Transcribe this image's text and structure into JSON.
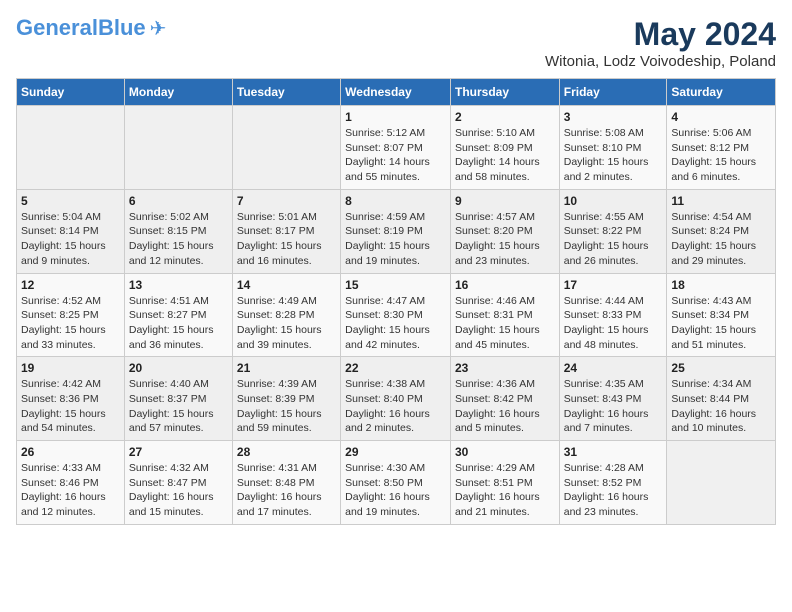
{
  "header": {
    "logo_general": "General",
    "logo_blue": "Blue",
    "main_title": "May 2024",
    "subtitle": "Witonia, Lodz Voivodeship, Poland"
  },
  "days_of_week": [
    "Sunday",
    "Monday",
    "Tuesday",
    "Wednesday",
    "Thursday",
    "Friday",
    "Saturday"
  ],
  "weeks": [
    [
      {
        "day": "",
        "info": ""
      },
      {
        "day": "",
        "info": ""
      },
      {
        "day": "",
        "info": ""
      },
      {
        "day": "1",
        "info": "Sunrise: 5:12 AM\nSunset: 8:07 PM\nDaylight: 14 hours\nand 55 minutes."
      },
      {
        "day": "2",
        "info": "Sunrise: 5:10 AM\nSunset: 8:09 PM\nDaylight: 14 hours\nand 58 minutes."
      },
      {
        "day": "3",
        "info": "Sunrise: 5:08 AM\nSunset: 8:10 PM\nDaylight: 15 hours\nand 2 minutes."
      },
      {
        "day": "4",
        "info": "Sunrise: 5:06 AM\nSunset: 8:12 PM\nDaylight: 15 hours\nand 6 minutes."
      }
    ],
    [
      {
        "day": "5",
        "info": "Sunrise: 5:04 AM\nSunset: 8:14 PM\nDaylight: 15 hours\nand 9 minutes."
      },
      {
        "day": "6",
        "info": "Sunrise: 5:02 AM\nSunset: 8:15 PM\nDaylight: 15 hours\nand 12 minutes."
      },
      {
        "day": "7",
        "info": "Sunrise: 5:01 AM\nSunset: 8:17 PM\nDaylight: 15 hours\nand 16 minutes."
      },
      {
        "day": "8",
        "info": "Sunrise: 4:59 AM\nSunset: 8:19 PM\nDaylight: 15 hours\nand 19 minutes."
      },
      {
        "day": "9",
        "info": "Sunrise: 4:57 AM\nSunset: 8:20 PM\nDaylight: 15 hours\nand 23 minutes."
      },
      {
        "day": "10",
        "info": "Sunrise: 4:55 AM\nSunset: 8:22 PM\nDaylight: 15 hours\nand 26 minutes."
      },
      {
        "day": "11",
        "info": "Sunrise: 4:54 AM\nSunset: 8:24 PM\nDaylight: 15 hours\nand 29 minutes."
      }
    ],
    [
      {
        "day": "12",
        "info": "Sunrise: 4:52 AM\nSunset: 8:25 PM\nDaylight: 15 hours\nand 33 minutes."
      },
      {
        "day": "13",
        "info": "Sunrise: 4:51 AM\nSunset: 8:27 PM\nDaylight: 15 hours\nand 36 minutes."
      },
      {
        "day": "14",
        "info": "Sunrise: 4:49 AM\nSunset: 8:28 PM\nDaylight: 15 hours\nand 39 minutes."
      },
      {
        "day": "15",
        "info": "Sunrise: 4:47 AM\nSunset: 8:30 PM\nDaylight: 15 hours\nand 42 minutes."
      },
      {
        "day": "16",
        "info": "Sunrise: 4:46 AM\nSunset: 8:31 PM\nDaylight: 15 hours\nand 45 minutes."
      },
      {
        "day": "17",
        "info": "Sunrise: 4:44 AM\nSunset: 8:33 PM\nDaylight: 15 hours\nand 48 minutes."
      },
      {
        "day": "18",
        "info": "Sunrise: 4:43 AM\nSunset: 8:34 PM\nDaylight: 15 hours\nand 51 minutes."
      }
    ],
    [
      {
        "day": "19",
        "info": "Sunrise: 4:42 AM\nSunset: 8:36 PM\nDaylight: 15 hours\nand 54 minutes."
      },
      {
        "day": "20",
        "info": "Sunrise: 4:40 AM\nSunset: 8:37 PM\nDaylight: 15 hours\nand 57 minutes."
      },
      {
        "day": "21",
        "info": "Sunrise: 4:39 AM\nSunset: 8:39 PM\nDaylight: 15 hours\nand 59 minutes."
      },
      {
        "day": "22",
        "info": "Sunrise: 4:38 AM\nSunset: 8:40 PM\nDaylight: 16 hours\nand 2 minutes."
      },
      {
        "day": "23",
        "info": "Sunrise: 4:36 AM\nSunset: 8:42 PM\nDaylight: 16 hours\nand 5 minutes."
      },
      {
        "day": "24",
        "info": "Sunrise: 4:35 AM\nSunset: 8:43 PM\nDaylight: 16 hours\nand 7 minutes."
      },
      {
        "day": "25",
        "info": "Sunrise: 4:34 AM\nSunset: 8:44 PM\nDaylight: 16 hours\nand 10 minutes."
      }
    ],
    [
      {
        "day": "26",
        "info": "Sunrise: 4:33 AM\nSunset: 8:46 PM\nDaylight: 16 hours\nand 12 minutes."
      },
      {
        "day": "27",
        "info": "Sunrise: 4:32 AM\nSunset: 8:47 PM\nDaylight: 16 hours\nand 15 minutes."
      },
      {
        "day": "28",
        "info": "Sunrise: 4:31 AM\nSunset: 8:48 PM\nDaylight: 16 hours\nand 17 minutes."
      },
      {
        "day": "29",
        "info": "Sunrise: 4:30 AM\nSunset: 8:50 PM\nDaylight: 16 hours\nand 19 minutes."
      },
      {
        "day": "30",
        "info": "Sunrise: 4:29 AM\nSunset: 8:51 PM\nDaylight: 16 hours\nand 21 minutes."
      },
      {
        "day": "31",
        "info": "Sunrise: 4:28 AM\nSunset: 8:52 PM\nDaylight: 16 hours\nand 23 minutes."
      },
      {
        "day": "",
        "info": ""
      }
    ]
  ]
}
